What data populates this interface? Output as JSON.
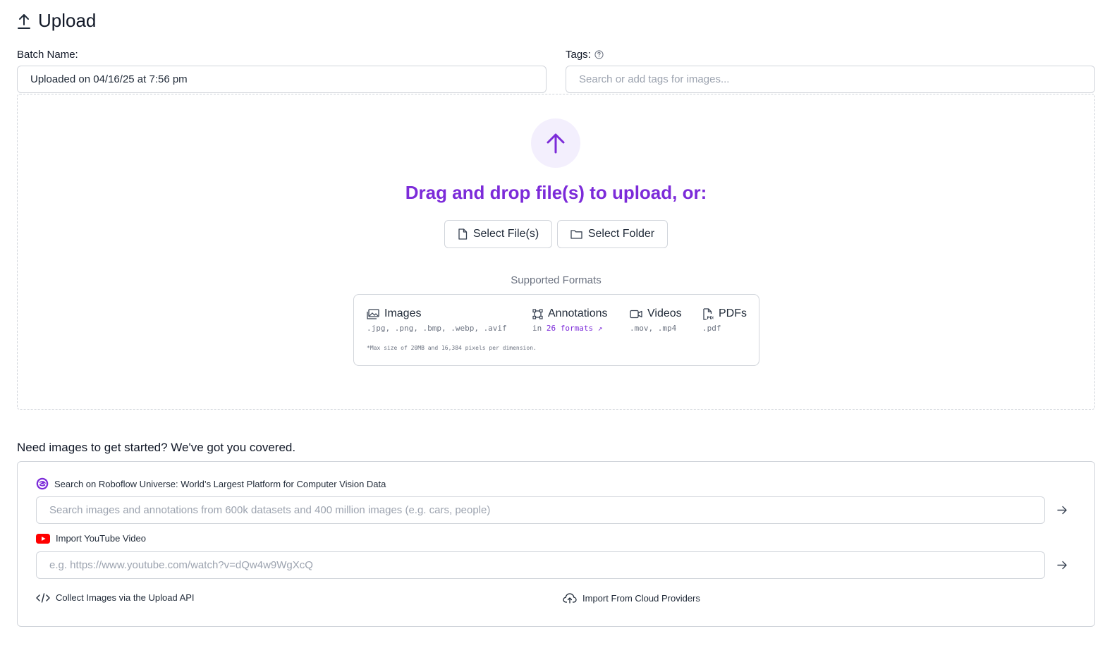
{
  "header": {
    "title": "Upload",
    "icon": "upload-icon"
  },
  "batch": {
    "label": "Batch Name:",
    "value": "Uploaded on 04/16/25 at 7:56 pm"
  },
  "tags": {
    "label": "Tags:",
    "placeholder": "Search or add tags for images...",
    "help_icon": "help-circle-icon"
  },
  "dropzone": {
    "title": "Drag and drop file(s) to upload, or:",
    "select_files": "Select File(s)",
    "select_folder": "Select Folder",
    "supported_title": "Supported Formats",
    "formats": {
      "images": {
        "name": "Images",
        "exts": ".jpg, .png, .bmp, .webp, .avif"
      },
      "annotations": {
        "name": "Annotations",
        "prefix": "in",
        "link": "26 formats",
        "arrow": "↗"
      },
      "videos": {
        "name": "Videos",
        "exts": ".mov, .mp4"
      },
      "pdfs": {
        "name": "PDFs",
        "exts": ".pdf"
      }
    },
    "max_note": "*Max size of 20MB and 16,384 pixels per dimension."
  },
  "resources": {
    "title": "Need images to get started? We've got you covered.",
    "universe": {
      "label": "Search on Roboflow Universe: World’s Largest Platform for Computer Vision Data",
      "placeholder": "Search images and annotations from 600k datasets and 400 million images (e.g. cars, people)"
    },
    "youtube": {
      "label": "Import YouTube Video",
      "placeholder": "e.g. https://www.youtube.com/watch?v=dQw4w9WgXcQ"
    },
    "api_link": "Collect Images via the Upload API",
    "cloud_link": "Import From Cloud Providers"
  },
  "colors": {
    "accent": "#7c2bd9",
    "accent_bg": "#f3effd",
    "youtube_red": "#ff0000",
    "border": "#d1d5db"
  }
}
